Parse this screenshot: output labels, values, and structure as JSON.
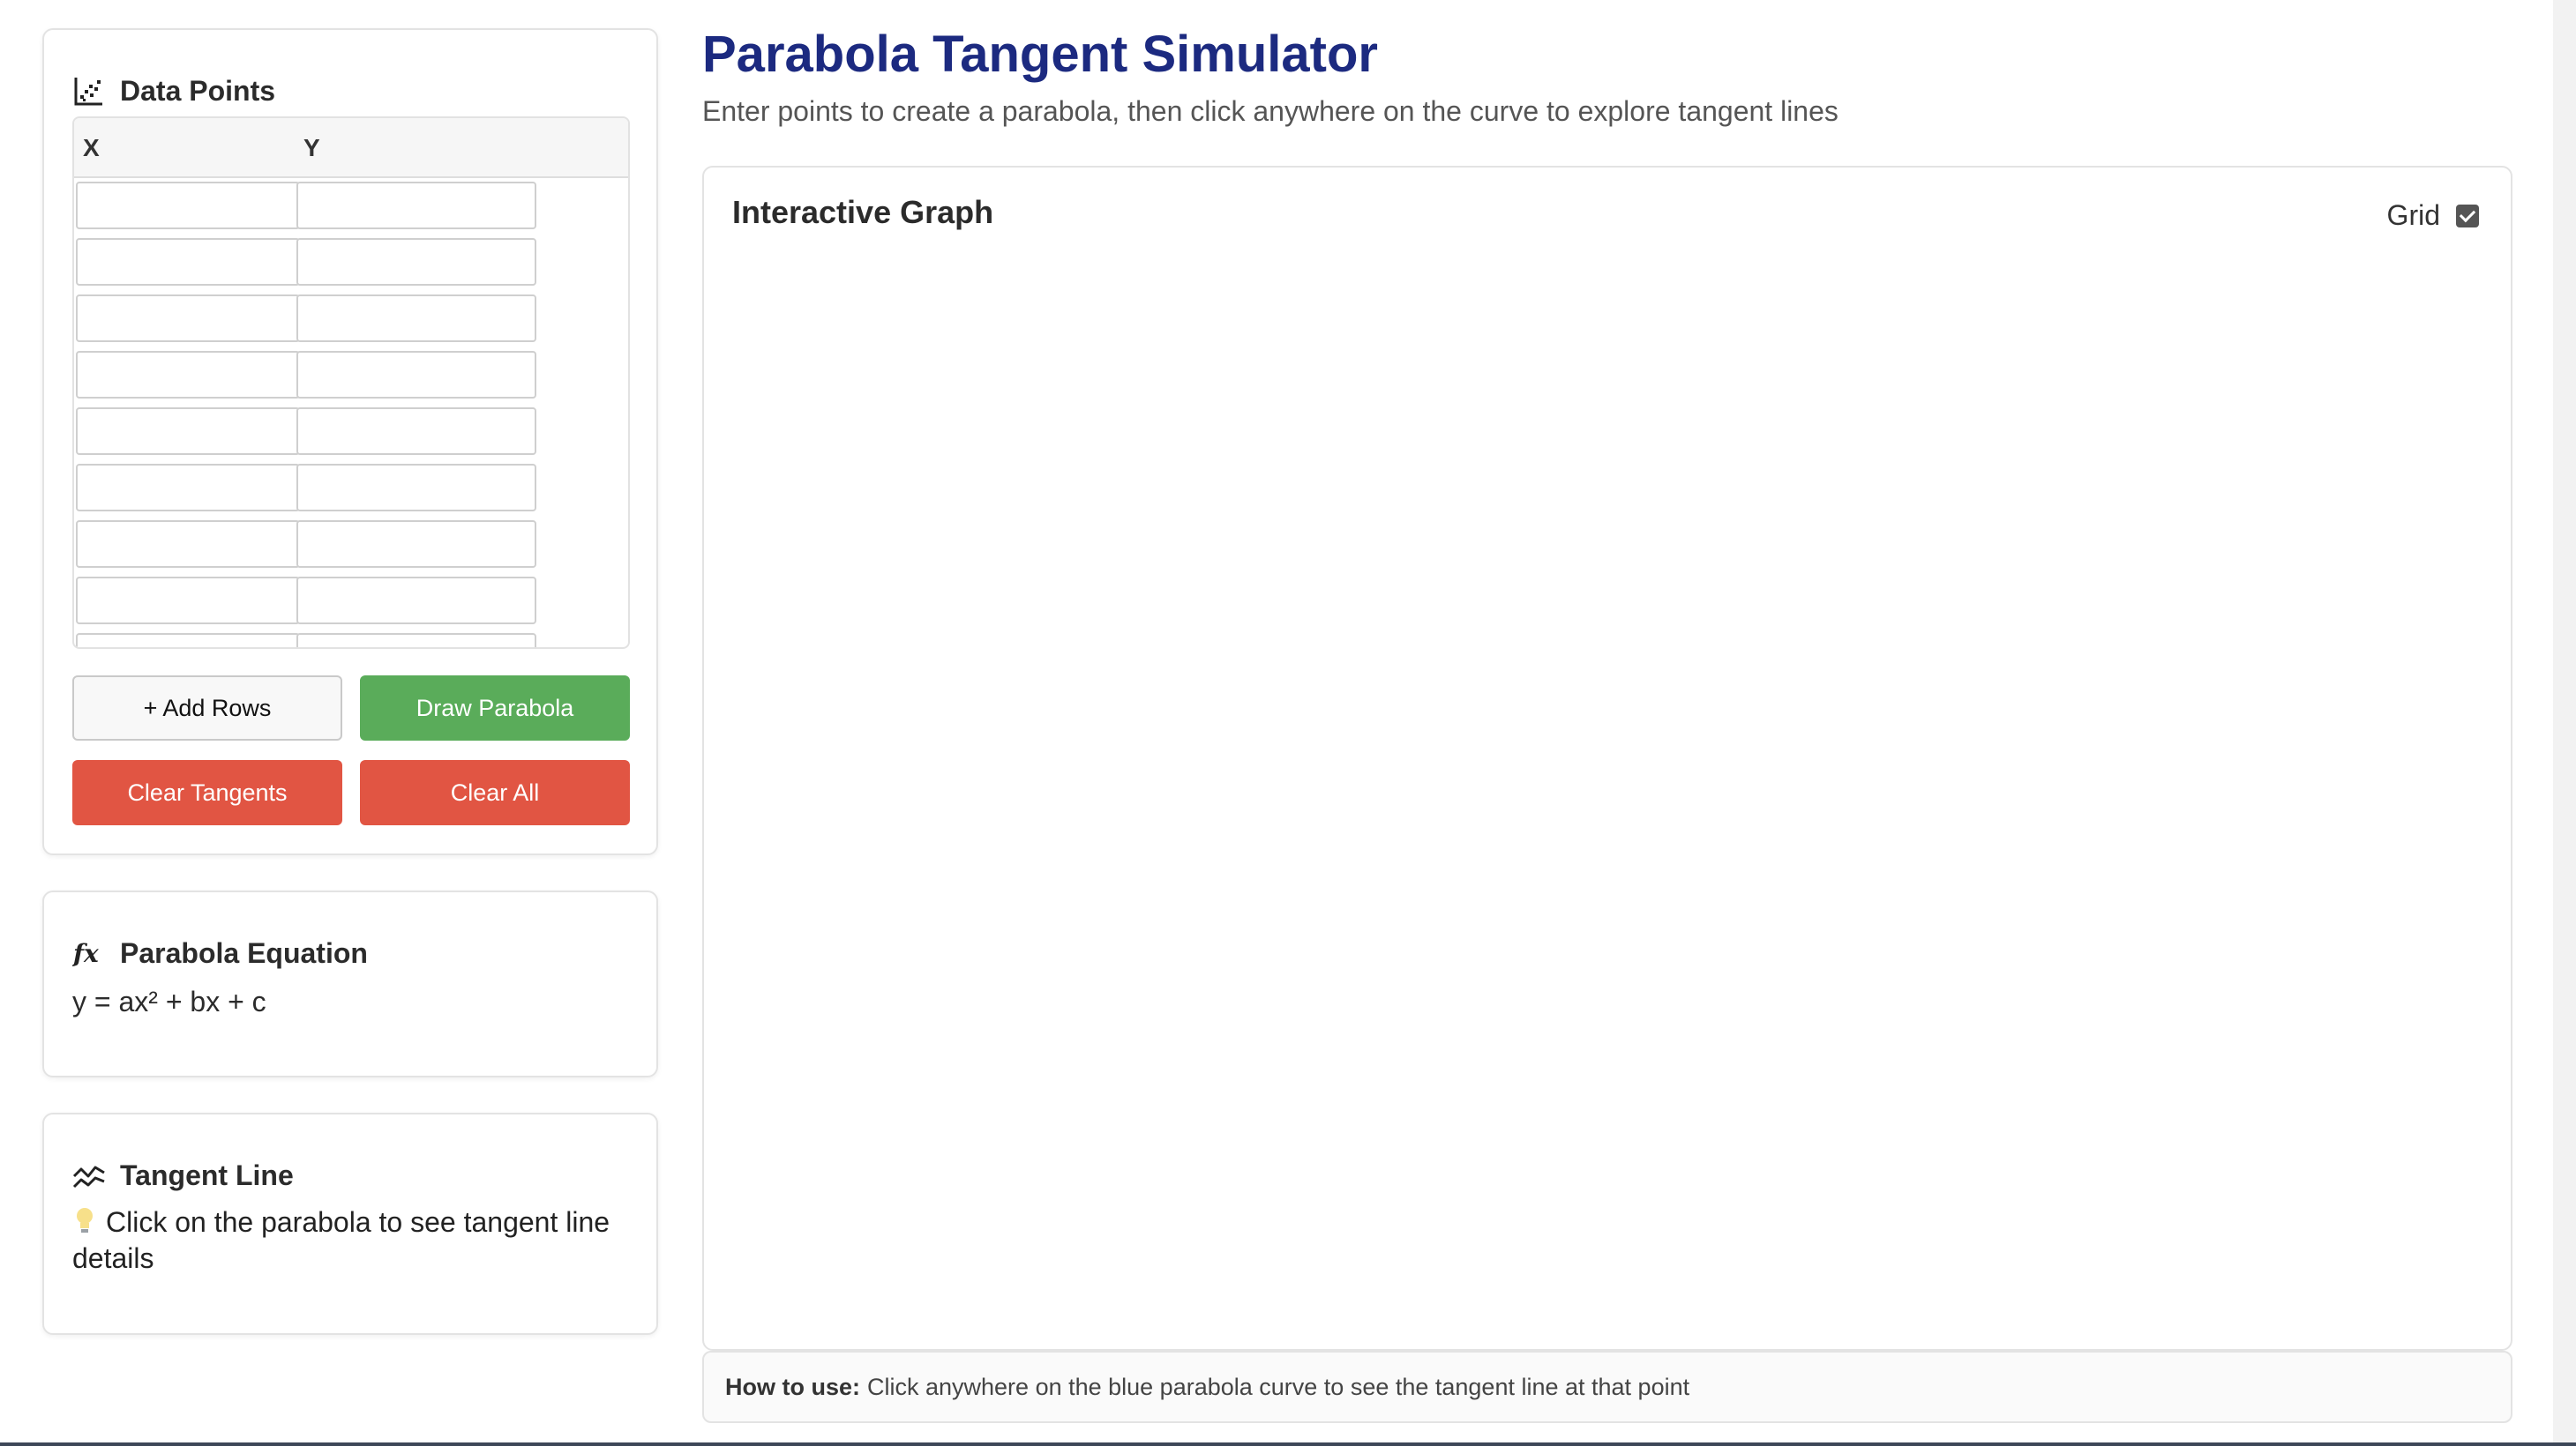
{
  "header": {
    "title": "Parabola Tangent Simulator",
    "subtitle": "Enter points to create a parabola, then click anywhere on the curve to explore tangent lines"
  },
  "data_points": {
    "title": "Data Points",
    "icon": "scatter-chart-icon",
    "columns": [
      "X",
      "Y"
    ],
    "rows": [
      {
        "x": "",
        "y": ""
      },
      {
        "x": "",
        "y": ""
      },
      {
        "x": "",
        "y": ""
      },
      {
        "x": "",
        "y": ""
      },
      {
        "x": "",
        "y": ""
      },
      {
        "x": "",
        "y": ""
      },
      {
        "x": "",
        "y": ""
      },
      {
        "x": "",
        "y": ""
      },
      {
        "x": "",
        "y": ""
      }
    ],
    "buttons": {
      "add_rows": "+ Add Rows",
      "draw_parabola": "Draw Parabola",
      "clear_tangents": "Clear Tangents",
      "clear_all": "Clear All"
    }
  },
  "equation": {
    "title": "Parabola Equation",
    "icon": "function-icon",
    "text": "y = ax² + bx + c"
  },
  "tangent": {
    "title": "Tangent Line",
    "icon": "line-chart-icon",
    "hint_icon": "lightbulb-icon",
    "text": "Click on the parabola to see tangent line details"
  },
  "graph": {
    "title": "Interactive Graph",
    "grid_label": "Grid",
    "grid_checked": true
  },
  "howto": {
    "label": "How to use:",
    "text": "Click anywhere on the blue parabola curve to see the tangent line at that point"
  },
  "colors": {
    "title": "#1c2a80",
    "draw_button": "#5aac5a",
    "danger_button": "#e15543"
  }
}
